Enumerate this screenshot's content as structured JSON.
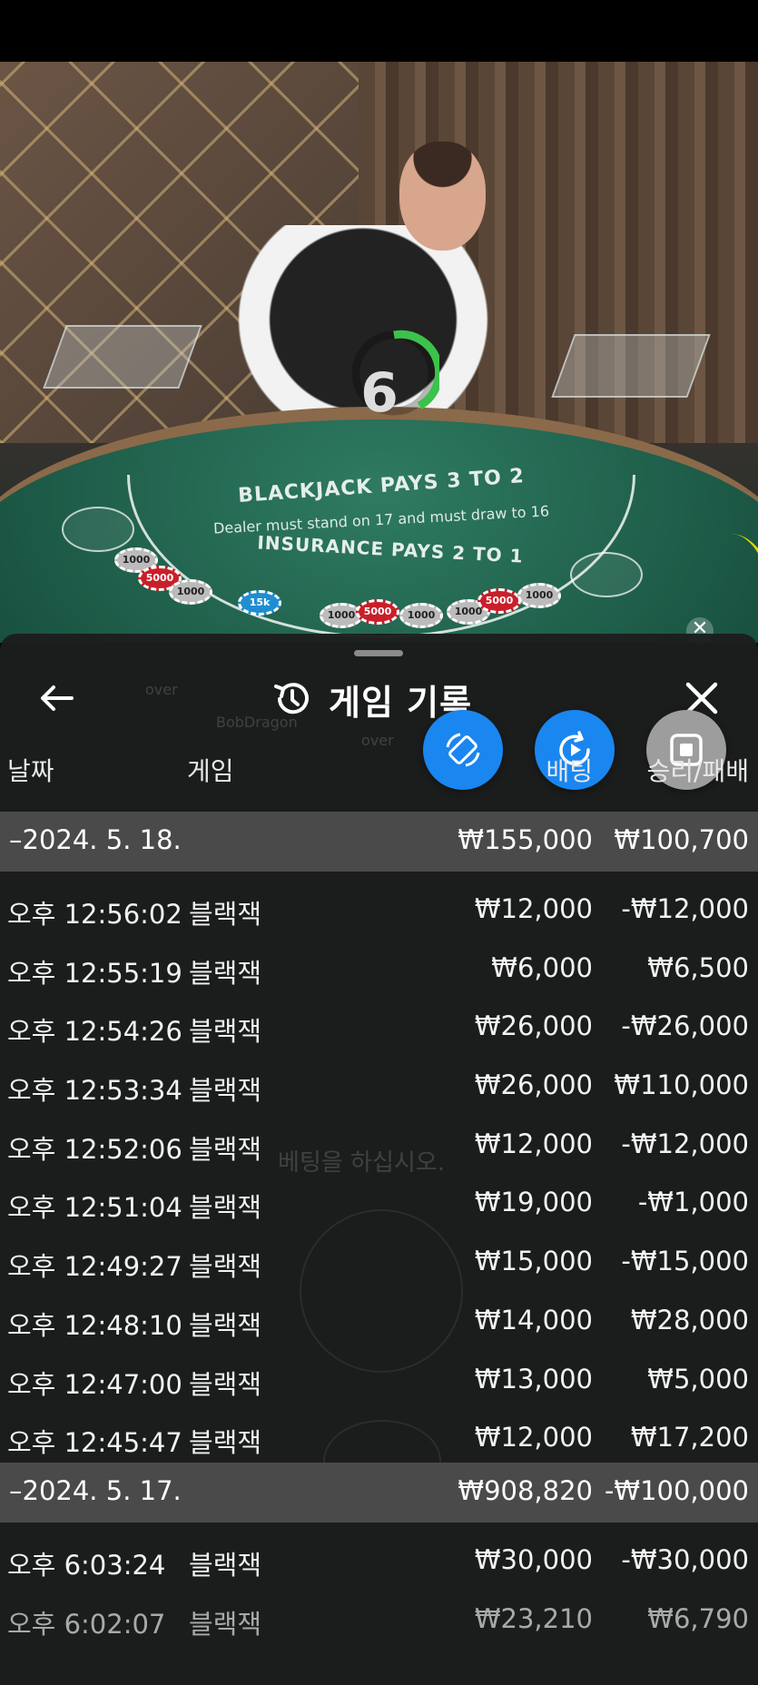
{
  "video": {
    "timer": "6",
    "table_line1": "BLACKJACK PAYS 3 TO 2",
    "table_line2": "Dealer must stand on 17 and must draw to 16",
    "table_line3": "INSURANCE PAYS 2 TO 1",
    "chips": [
      "1000",
      "5000",
      "1000",
      "15k",
      "1000",
      "5000",
      "1000",
      "1000",
      "5000",
      "1000"
    ]
  },
  "panel": {
    "title": "게임 기록",
    "columns": {
      "date": "날짜",
      "game": "게임",
      "bet": "배팅",
      "win_loss": "승리/패배"
    },
    "groups": [
      {
        "date": "–2024. 5. 18.",
        "bet_total": "₩155,000",
        "win_loss_total": "₩100,700",
        "rows": [
          {
            "time": "오후 12:56:02",
            "game": "블랙잭",
            "bet": "₩12,000",
            "win_loss": "-₩12,000"
          },
          {
            "time": "오후 12:55:19",
            "game": "블랙잭",
            "bet": "₩6,000",
            "win_loss": "₩6,500"
          },
          {
            "time": "오후 12:54:26",
            "game": "블랙잭",
            "bet": "₩26,000",
            "win_loss": "-₩26,000"
          },
          {
            "time": "오후 12:53:34",
            "game": "블랙잭",
            "bet": "₩26,000",
            "win_loss": "₩110,000"
          },
          {
            "time": "오후 12:52:06",
            "game": "블랙잭",
            "bet": "₩12,000",
            "win_loss": "-₩12,000"
          },
          {
            "time": "오후 12:51:04",
            "game": "블랙잭",
            "bet": "₩19,000",
            "win_loss": "-₩1,000"
          },
          {
            "time": "오후 12:49:27",
            "game": "블랙잭",
            "bet": "₩15,000",
            "win_loss": "-₩15,000"
          },
          {
            "time": "오후 12:48:10",
            "game": "블랙잭",
            "bet": "₩14,000",
            "win_loss": "₩28,000"
          },
          {
            "time": "오후 12:47:00",
            "game": "블랙잭",
            "bet": "₩13,000",
            "win_loss": "₩5,000"
          },
          {
            "time": "오후 12:45:47",
            "game": "블랙잭",
            "bet": "₩12,000",
            "win_loss": "₩17,200"
          }
        ]
      },
      {
        "date": "–2024. 5. 17.",
        "bet_total": "₩908,820",
        "win_loss_total": "-₩100,000",
        "rows": [
          {
            "time": "오후 6:03:24",
            "game": "블랙잭",
            "bet": "₩30,000",
            "win_loss": "-₩30,000"
          },
          {
            "time": "오후 6:02:07",
            "game": "블랙잭",
            "bet": "₩23,210",
            "win_loss": "₩6,790"
          }
        ]
      }
    ],
    "background_hint": {
      "place_bets": "베팅을 하십시오.",
      "seat_name": "BobDragon",
      "over_left": "over",
      "over_mid": "over"
    }
  },
  "colors": {
    "accent_blue": "#1a86f0",
    "panel_bg": "#1c1e1e",
    "date_row_bg": "#4a4a4a",
    "timer_green": "#3cc24a"
  },
  "icons": {
    "back": "arrow-left-icon",
    "history": "history-icon",
    "close": "close-icon",
    "float1": "rotate-device-icon",
    "float2": "replay-video-icon",
    "float3": "stop-icon"
  }
}
